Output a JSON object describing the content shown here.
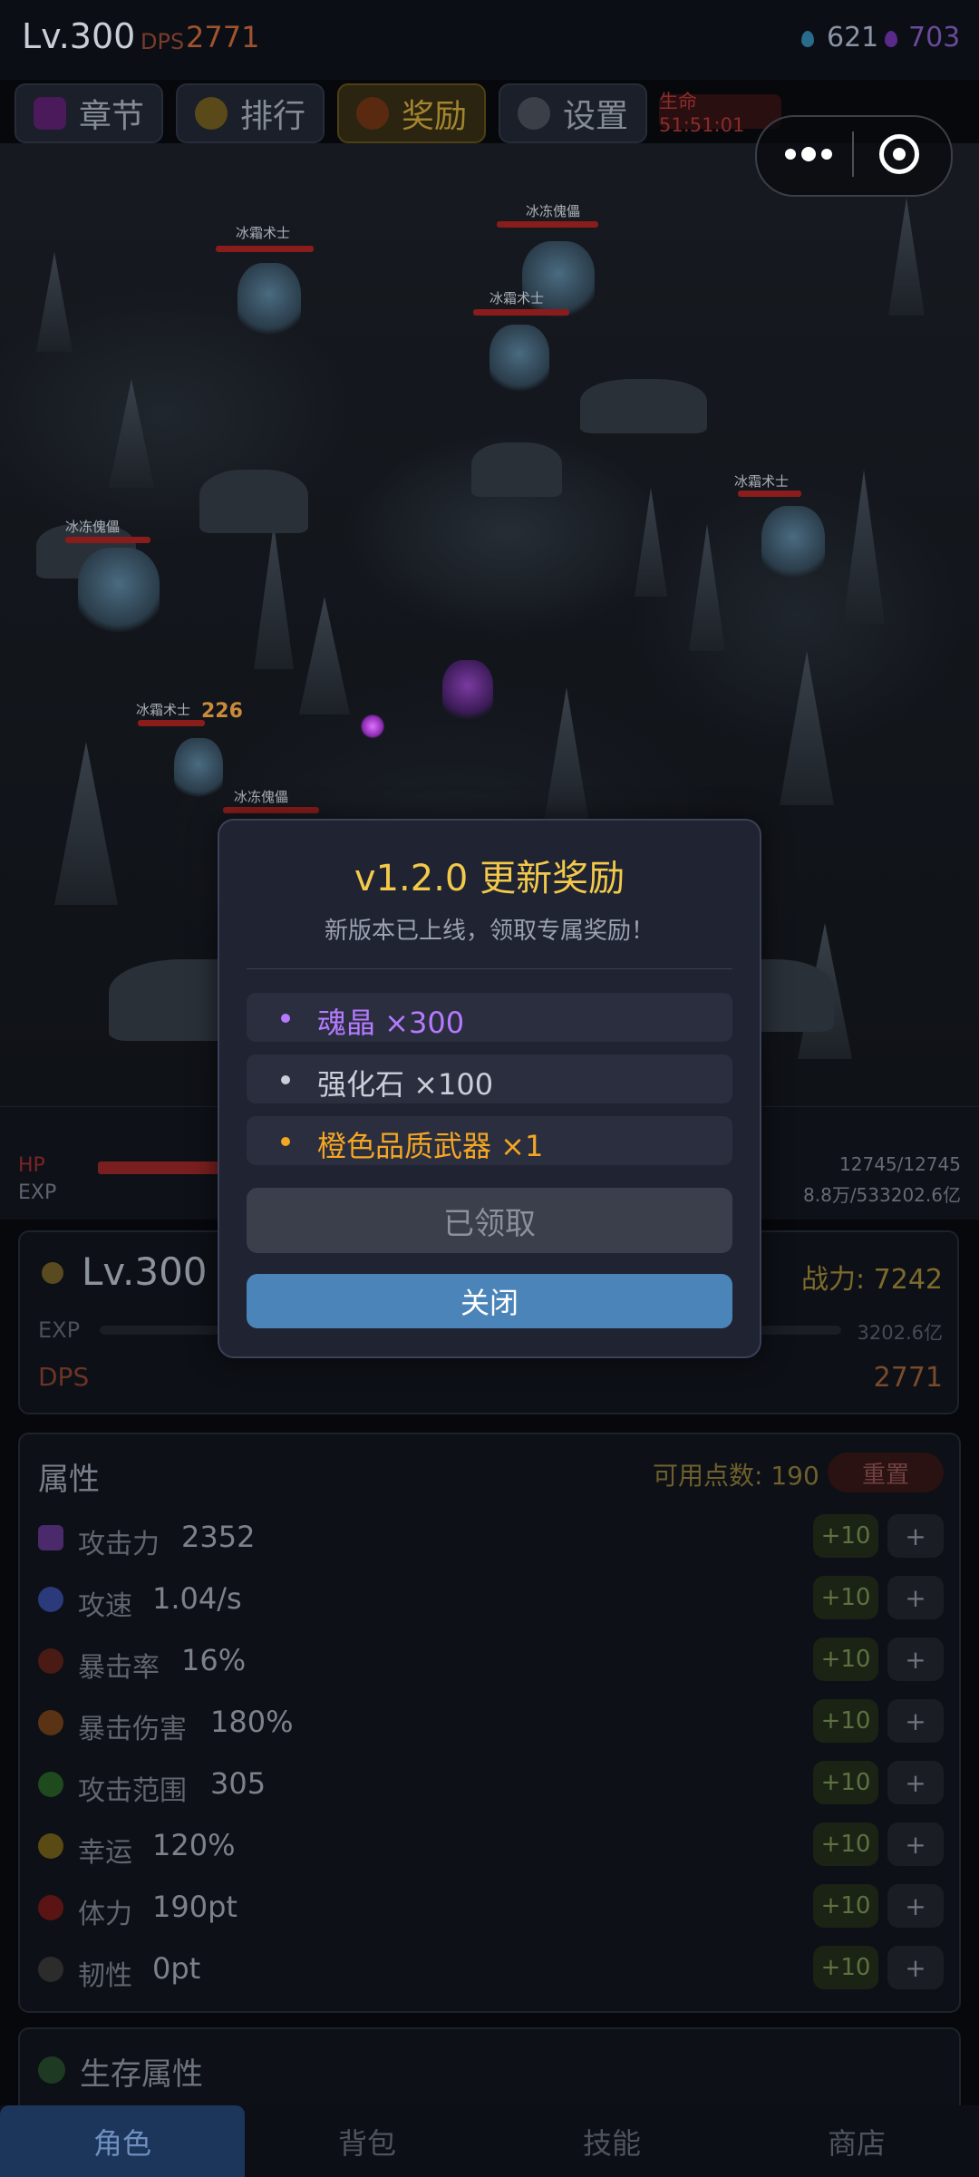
{
  "topbar": {
    "level": "Lv.300",
    "dps_label": "DPS",
    "dps_value": "2771",
    "currency1": "621",
    "currency2": "703",
    "currency1_color": "#3aa0c8",
    "currency2_color": "#9a4ad8"
  },
  "nav": {
    "chapter": "章节",
    "ranking": "排行",
    "rewards": "奖励",
    "settings": "设置",
    "timer": "生命 51:51:01"
  },
  "scene": {
    "enemies": [
      {
        "name": "冰霜术士"
      },
      {
        "name": "冰冻傀儡"
      },
      {
        "name": "冰霜术士"
      },
      {
        "name": "冰冻傀儡"
      },
      {
        "name": "冰霜术士"
      },
      {
        "name": "冰霜术士"
      },
      {
        "name": "冰冻傀儡"
      }
    ],
    "damage_number": "226"
  },
  "status": {
    "hp_label": "HP",
    "exp_label": "EXP",
    "hp_value": "12745/12745",
    "exp_value": "8.8万/533202.6亿"
  },
  "character": {
    "level": "Lv.300",
    "power": "战力: 7242",
    "exp_label": "EXP",
    "exp_value": "3202.6亿",
    "dps_label": "DPS",
    "dps_value": "2771"
  },
  "attributes": {
    "title": "属性",
    "available_points": "可用点数: 190",
    "reset": "重置",
    "plus10": "+10",
    "plus": "+",
    "rows": [
      {
        "name": "攻击力",
        "value": "2352",
        "icon": "sword-icon",
        "color": "#6a3a8a"
      },
      {
        "name": "攻速",
        "value": "1.04/s",
        "icon": "speed-icon",
        "color": "#3a4a9a"
      },
      {
        "name": "暴击率",
        "value": "16%",
        "icon": "crit-rate-icon",
        "color": "#6a2a1a"
      },
      {
        "name": "暴击伤害",
        "value": "180%",
        "icon": "crit-damage-icon",
        "color": "#7a4a1a"
      },
      {
        "name": "攻击范围",
        "value": "305",
        "icon": "range-icon",
        "color": "#2a5a2a"
      },
      {
        "name": "幸运",
        "value": "120%",
        "icon": "luck-icon",
        "color": "#6a5a1a"
      },
      {
        "name": "体力",
        "value": "190pt",
        "icon": "stamina-icon",
        "color": "#6a1a1a"
      },
      {
        "name": "韧性",
        "value": "0pt",
        "icon": "toughness-icon",
        "color": "#3a3a3a"
      }
    ]
  },
  "survival": {
    "title": "生存属性"
  },
  "tabs": [
    {
      "label": "角色"
    },
    {
      "label": "背包"
    },
    {
      "label": "技能"
    },
    {
      "label": "商店"
    }
  ],
  "modal": {
    "title": "v1.2.0 更新奖励",
    "subtitle": "新版本已上线，领取专属奖励！",
    "items": [
      {
        "text": "魂晶 ×300",
        "color": "#b57aff"
      },
      {
        "text": "强化石 ×100",
        "color": "#c9ced8"
      },
      {
        "text": "橙色品质武器 ×1",
        "color": "#f5a623"
      }
    ],
    "claimed": "已领取",
    "close": "关闭"
  }
}
